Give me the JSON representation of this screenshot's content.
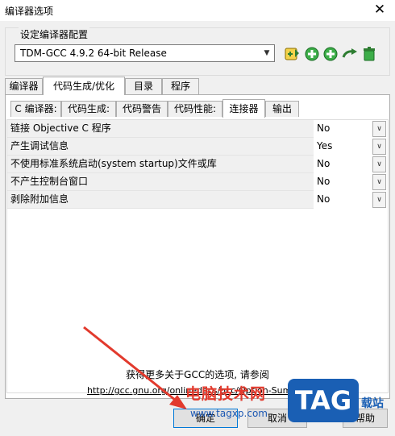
{
  "window": {
    "title": "编译器选项",
    "close_glyph": "✕"
  },
  "compiler_set": {
    "legend": "设定编译器配置",
    "selected": "TDM-GCC 4.9.2 64-bit Release",
    "toolbar_icons": [
      "star-icon",
      "add-icon",
      "add-icon",
      "rename-icon",
      "delete-icon"
    ]
  },
  "main_tabs": [
    {
      "label": "编译器"
    },
    {
      "label": "代码生成/优化"
    },
    {
      "label": "目录"
    },
    {
      "label": "程序"
    }
  ],
  "sub_tabs": [
    {
      "label": "C 编译器:"
    },
    {
      "label": "代码生成:"
    },
    {
      "label": "代码警告"
    },
    {
      "label": "代码性能:"
    },
    {
      "label": "连接器"
    },
    {
      "label": "输出"
    }
  ],
  "options": [
    {
      "name": "链接 Objective C 程序",
      "value": "No"
    },
    {
      "name": "产生调试信息",
      "value": "Yes"
    },
    {
      "name": "不使用标准系统启动(system startup)文件或库",
      "value": "No"
    },
    {
      "name": "不产生控制台窗口",
      "value": "No"
    },
    {
      "name": "剥除附加信息",
      "value": "No"
    }
  ],
  "info_text": "获得更多关于GCC的选项, 请参阅",
  "link_text": "http://gcc.gnu.org/onlinedocs/gcc/Option-Summary",
  "buttons": {
    "ok": "确定",
    "cancel": "取消",
    "help": "帮助"
  },
  "watermark": {
    "brand": "电脑技术网",
    "url": "www.tagxp.com",
    "logo": "TAG",
    "tail": "载站"
  },
  "colors": {
    "accent": "#0078d7",
    "annotation_arrow": "#e23a2d",
    "watermark_blue": "#1a5fb4"
  }
}
